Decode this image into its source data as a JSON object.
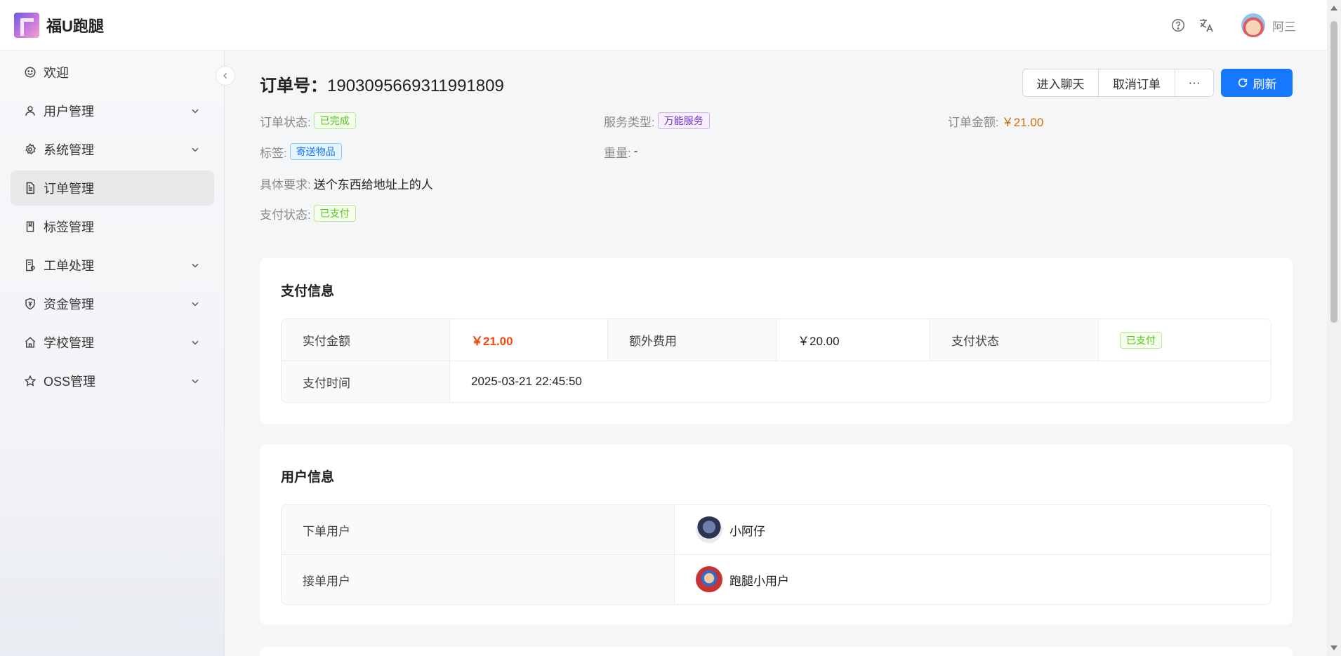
{
  "app": {
    "title": "福U跑腿",
    "user_name": "阿三"
  },
  "sidebar": {
    "items": [
      {
        "label": "欢迎",
        "icon": "smile-icon",
        "has_children": false
      },
      {
        "label": "用户管理",
        "icon": "user-icon",
        "has_children": true
      },
      {
        "label": "系统管理",
        "icon": "gear-icon",
        "has_children": true
      },
      {
        "label": "订单管理",
        "icon": "file-icon",
        "has_children": false,
        "active": true
      },
      {
        "label": "标签管理",
        "icon": "book-icon",
        "has_children": false
      },
      {
        "label": "工单处理",
        "icon": "ticket-icon",
        "has_children": true
      },
      {
        "label": "资金管理",
        "icon": "shield-yen-icon",
        "has_children": true
      },
      {
        "label": "学校管理",
        "icon": "home-icon",
        "has_children": true
      },
      {
        "label": "OSS管理",
        "icon": "star-icon",
        "has_children": true
      }
    ]
  },
  "order": {
    "title_label": "订单号：",
    "number": "1903095669311991809",
    "buttons": {
      "chat": "进入聊天",
      "cancel": "取消订单",
      "more": "···",
      "refresh": "刷新"
    },
    "fields": {
      "status_label": "订单状态:",
      "status_value": "已完成",
      "service_label": "服务类型:",
      "service_value": "万能服务",
      "amount_label": "订单金额:",
      "amount_value": "￥21.00",
      "tag_label": "标签:",
      "tag_value": "寄送物品",
      "weight_label": "重量:",
      "weight_value": "-",
      "req_label": "具体要求:",
      "req_value": "送个东西给地址上的人",
      "pay_status_label": "支付状态:",
      "pay_status_value": "已支付"
    }
  },
  "payment": {
    "title": "支付信息",
    "paid_label": "实付金额",
    "paid_value": "￥21.00",
    "extra_label": "额外费用",
    "extra_value": "￥20.00",
    "status_label": "支付状态",
    "status_value": "已支付",
    "time_label": "支付时间",
    "time_value": "2025-03-21 22:45:50"
  },
  "users": {
    "title": "用户信息",
    "orderer_label": "下单用户",
    "orderer_name": "小阿仔",
    "runner_label": "接单用户",
    "runner_name": "跑腿小用户"
  },
  "colors": {
    "primary": "#1677ff",
    "paid": "#f5480e",
    "amount": "#d46b08",
    "success": "#52c41a",
    "purple": "#722ed1"
  }
}
